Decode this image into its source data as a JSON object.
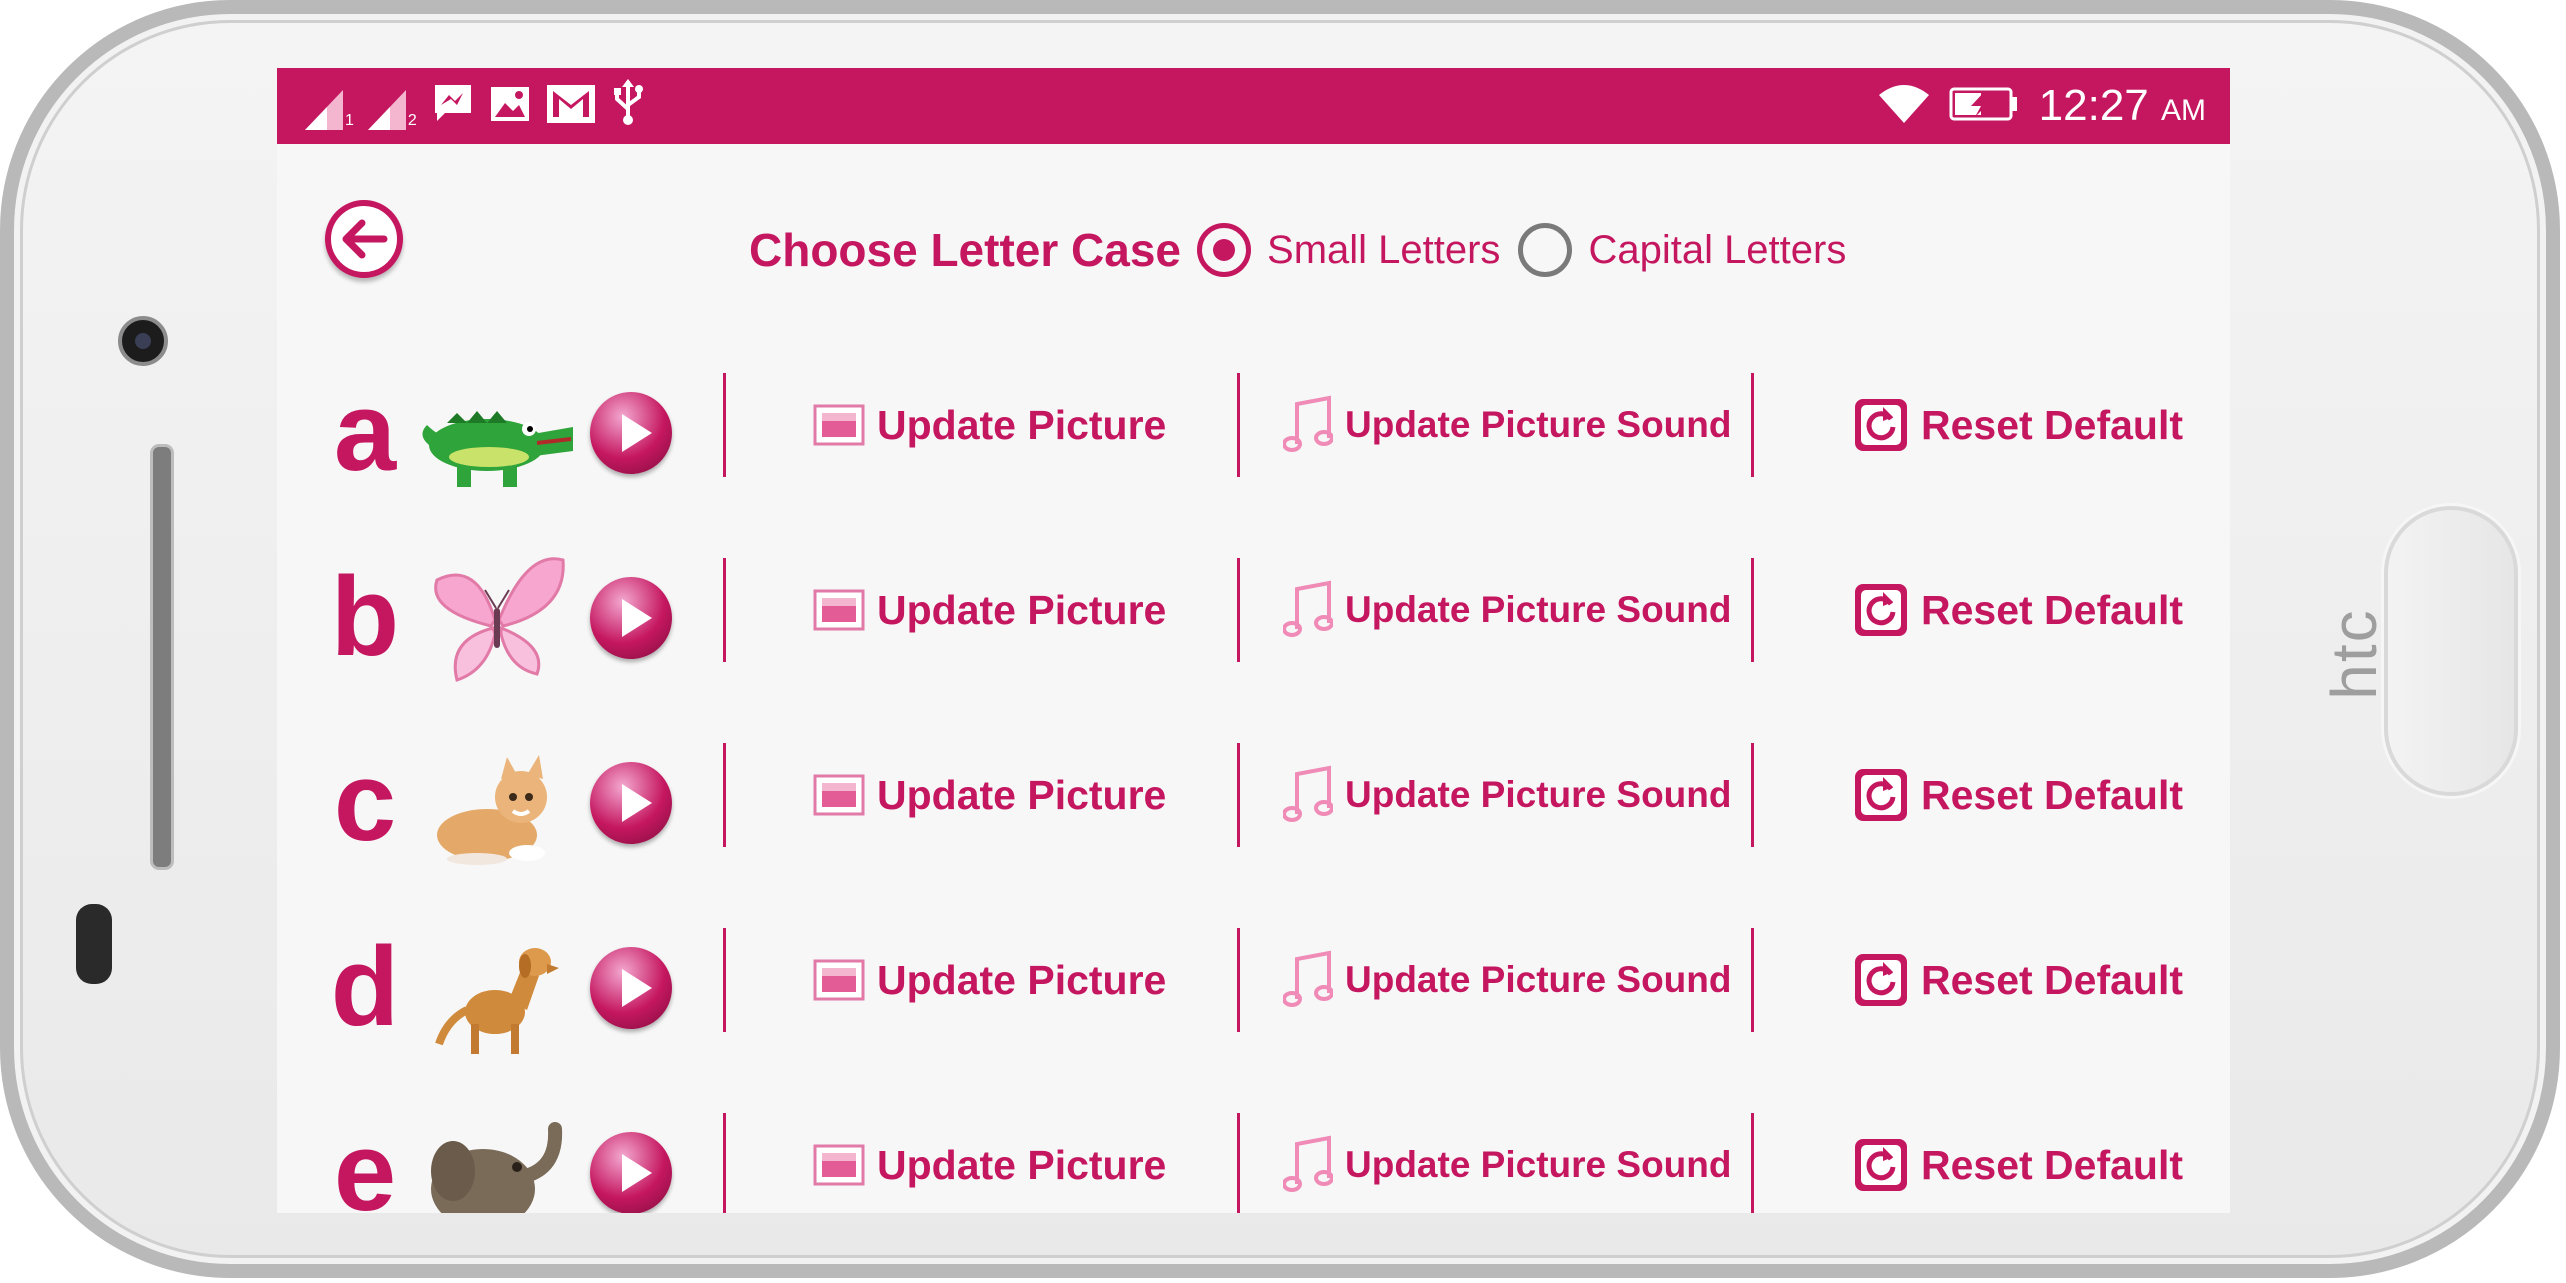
{
  "status_bar": {
    "sim1_label": "1",
    "sim2_label": "2",
    "icons": [
      "signal-icon",
      "signal-icon",
      "messenger-icon",
      "image-icon",
      "gmail-icon",
      "usb-icon",
      "wifi-icon",
      "battery-charging-icon"
    ],
    "time": "12:27",
    "ampm": "AM"
  },
  "device": {
    "brand": "htc"
  },
  "header": {
    "title": "Choose Letter Case",
    "options": [
      {
        "label": "Small Letters",
        "selected": true
      },
      {
        "label": "Capital Letters",
        "selected": false
      }
    ]
  },
  "actions": {
    "update_picture": "Update Picture",
    "update_sound": "Update Picture Sound",
    "reset": "Reset Default"
  },
  "rows": [
    {
      "letter": "a",
      "animal": "crocodile-picture"
    },
    {
      "letter": "b",
      "animal": "butterfly-picture"
    },
    {
      "letter": "c",
      "animal": "cat-picture"
    },
    {
      "letter": "d",
      "animal": "dog-picture"
    },
    {
      "letter": "e",
      "animal": "elephant-picture"
    }
  ],
  "colors": {
    "accent": "#c51760",
    "background": "#f7f7f7"
  }
}
